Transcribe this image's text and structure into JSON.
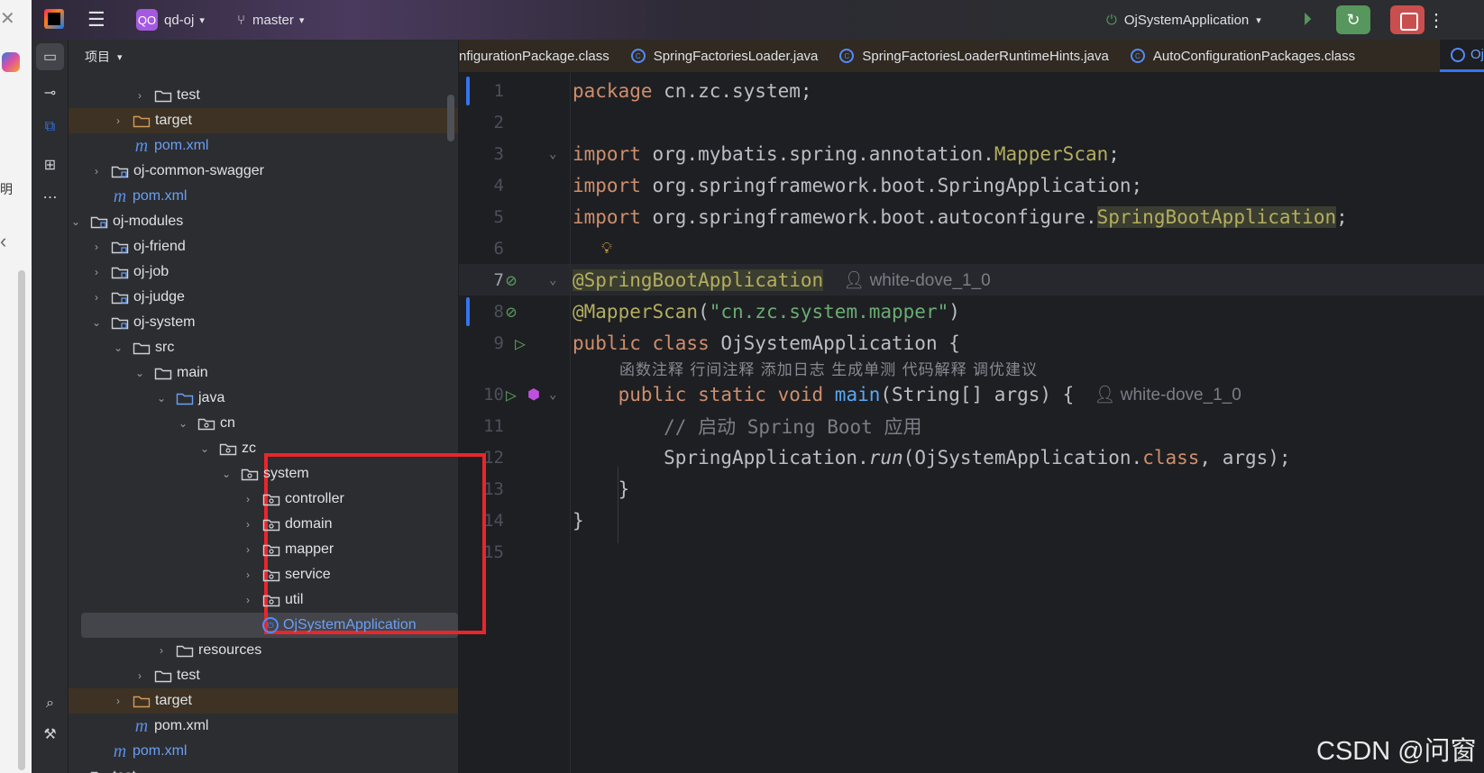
{
  "topbar": {
    "project_badge": "QO",
    "project": "qd-oj",
    "branch": "master",
    "run_config": "OjSystemApplication"
  },
  "panel": {
    "title": "项目"
  },
  "tree": [
    {
      "label": "test",
      "depth": 3,
      "type": "folder",
      "chev": ">"
    },
    {
      "label": "target",
      "depth": 2,
      "type": "folder-orange",
      "chev": ">",
      "style": "brown"
    },
    {
      "label": "pom.xml",
      "depth": 2,
      "type": "maven",
      "style": "blue"
    },
    {
      "label": "oj-common-swagger",
      "depth": 1,
      "type": "module",
      "chev": ">"
    },
    {
      "label": "pom.xml",
      "depth": 1,
      "type": "maven",
      "style": "blue"
    },
    {
      "label": "oj-modules",
      "depth": 0,
      "type": "module",
      "chev": "v"
    },
    {
      "label": "oj-friend",
      "depth": 1,
      "type": "module",
      "chev": ">"
    },
    {
      "label": "oj-job",
      "depth": 1,
      "type": "module",
      "chev": ">"
    },
    {
      "label": "oj-judge",
      "depth": 1,
      "type": "module",
      "chev": ">"
    },
    {
      "label": "oj-system",
      "depth": 1,
      "type": "module",
      "chev": "v"
    },
    {
      "label": "src",
      "depth": 2,
      "type": "folder",
      "chev": "v"
    },
    {
      "label": "main",
      "depth": 3,
      "type": "folder",
      "chev": "v"
    },
    {
      "label": "java",
      "depth": 4,
      "type": "folder-blue",
      "chev": "v"
    },
    {
      "label": "cn",
      "depth": 5,
      "type": "package",
      "chev": "v"
    },
    {
      "label": "zc",
      "depth": 6,
      "type": "package",
      "chev": "v"
    },
    {
      "label": "system",
      "depth": 7,
      "type": "package",
      "chev": "v"
    },
    {
      "label": "controller",
      "depth": 8,
      "type": "package",
      "chev": ">"
    },
    {
      "label": "domain",
      "depth": 8,
      "type": "package",
      "chev": ">"
    },
    {
      "label": "mapper",
      "depth": 8,
      "type": "package",
      "chev": ">"
    },
    {
      "label": "service",
      "depth": 8,
      "type": "package",
      "chev": ">"
    },
    {
      "label": "util",
      "depth": 8,
      "type": "package",
      "chev": ">"
    },
    {
      "label": "OjSystemApplication",
      "depth": 8,
      "type": "class",
      "style": "sel"
    },
    {
      "label": "resources",
      "depth": 4,
      "type": "folder",
      "chev": ">"
    },
    {
      "label": "test",
      "depth": 3,
      "type": "folder",
      "chev": ">"
    },
    {
      "label": "target",
      "depth": 2,
      "type": "folder-orange",
      "chev": ">",
      "style": "brown"
    },
    {
      "label": "pom.xml",
      "depth": 2,
      "type": "maven"
    },
    {
      "label": "pom.xml",
      "depth": 1,
      "type": "maven",
      "style": "blue"
    },
    {
      "label": "test",
      "depth": 0,
      "type": "folder",
      "chev": ">"
    }
  ],
  "tabs": [
    "nfigurationPackage.class",
    "SpringFactoriesLoader.java",
    "SpringFactoriesLoaderRuntimeHints.java",
    "AutoConfigurationPackages.class"
  ],
  "active_tab": "OjSystemApplication.java",
  "code": [
    {
      "n": "1",
      "t": [
        [
          "kw",
          "package "
        ],
        [
          "",
          "cn.zc.system;"
        ]
      ]
    },
    {
      "n": "2",
      "t": []
    },
    {
      "n": "3",
      "t": [
        [
          "kw",
          "import "
        ],
        [
          "",
          "org.mybatis.spring.annotation."
        ],
        [
          "an",
          "MapperScan"
        ],
        [
          "",
          ";"
        ]
      ]
    },
    {
      "n": "4",
      "t": [
        [
          "kw",
          "import "
        ],
        [
          "",
          "org.springframework.boot.SpringApplication;"
        ]
      ]
    },
    {
      "n": "5",
      "t": [
        [
          "kw",
          "import "
        ],
        [
          "",
          "org.springframework.boot.autoconfigure."
        ],
        [
          "an hl",
          "SpringBootApplication"
        ],
        [
          "",
          ";"
        ]
      ]
    },
    {
      "n": "6",
      "t": []
    },
    {
      "n": "7",
      "t": [
        [
          "an hl",
          "@SpringBootApplication"
        ]
      ],
      "author": "white-dove_1_0",
      "cur": true
    },
    {
      "n": "8",
      "t": [
        [
          "an",
          "@MapperScan"
        ],
        [
          "",
          "("
        ],
        [
          "st",
          "\"cn.zc.system.mapper\""
        ],
        [
          "",
          ")"
        ]
      ]
    },
    {
      "n": "9",
      "t": [
        [
          "kw",
          "public class "
        ],
        [
          "",
          "OjSystemApplication {"
        ]
      ]
    },
    {
      "n": "10",
      "t": [
        [
          "",
          "    "
        ],
        [
          "kw",
          "public static void "
        ],
        [
          "fn",
          "main"
        ],
        [
          "",
          "(String[] args) {"
        ]
      ],
      "author": "white-dove_1_0"
    },
    {
      "n": "11",
      "t": [
        [
          "",
          "        "
        ],
        [
          "cm",
          "// 启动 Spring Boot 应用"
        ]
      ]
    },
    {
      "n": "12",
      "t": [
        [
          "",
          "        SpringApplication."
        ],
        [
          "it",
          "run"
        ],
        [
          "",
          "(OjSystemApplication."
        ],
        [
          "kw",
          "class"
        ],
        [
          "",
          ", args);"
        ]
      ]
    },
    {
      "n": "13",
      "t": [
        [
          "",
          "    }"
        ]
      ]
    },
    {
      "n": "14",
      "t": [
        [
          "",
          "}"
        ]
      ]
    },
    {
      "n": "15",
      "t": []
    }
  ],
  "inlay": "函数注释 行间注释 添加日志 生成单测 代码解释 调优建议",
  "watermark": "CSDN @问窗",
  "browser": {
    "ming": "明"
  }
}
